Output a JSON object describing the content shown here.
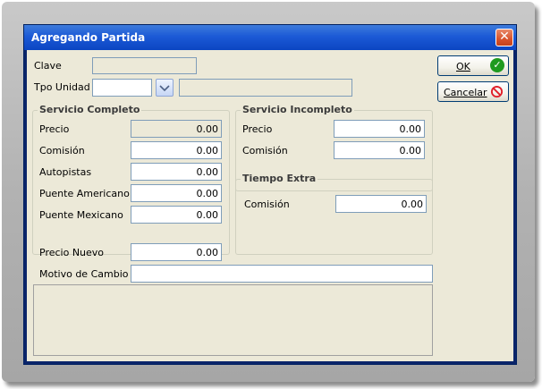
{
  "window": {
    "title": "Agregando Partida"
  },
  "form": {
    "clave": {
      "label": "Clave",
      "value": ""
    },
    "tpo_unidad": {
      "label": "Tpo Unidad",
      "value": "",
      "description": ""
    }
  },
  "servicio_completo": {
    "title": "Servicio Completo",
    "precio": {
      "label": "Precio",
      "value": "0.00"
    },
    "comision": {
      "label": "Comisión",
      "value": "0.00"
    },
    "autopistas": {
      "label": "Autopistas",
      "value": "0.00"
    },
    "puente_americano": {
      "label": "Puente Americano",
      "value": "0.00"
    },
    "puente_mexicano": {
      "label": "Puente Mexicano",
      "value": "0.00"
    }
  },
  "servicio_incompleto": {
    "title": "Servicio Incompleto",
    "precio": {
      "label": "Precio",
      "value": "0.00"
    },
    "comision": {
      "label": "Comisión",
      "value": "0.00"
    }
  },
  "tiempo_extra": {
    "title": "Tiempo Extra",
    "comision": {
      "label": "Comisión",
      "value": "0.00"
    }
  },
  "precio_nuevo": {
    "label": "Precio Nuevo",
    "value": "0.00"
  },
  "motivo_cambio": {
    "label": "Motivo de Cambio",
    "value": ""
  },
  "buttons": {
    "ok": "OK",
    "cancel": "Cancelar"
  },
  "icons": {
    "close": "close-icon",
    "ok": "checkmark-icon",
    "cancel": "no-entry-icon",
    "dropdown": "chevron-down-icon"
  },
  "colors": {
    "titlebar": "#0b45c2",
    "client_bg": "#ece9d8",
    "ok_green": "#1f9a1f",
    "cancel_red": "#e0202a",
    "close_red": "#d8532c"
  }
}
